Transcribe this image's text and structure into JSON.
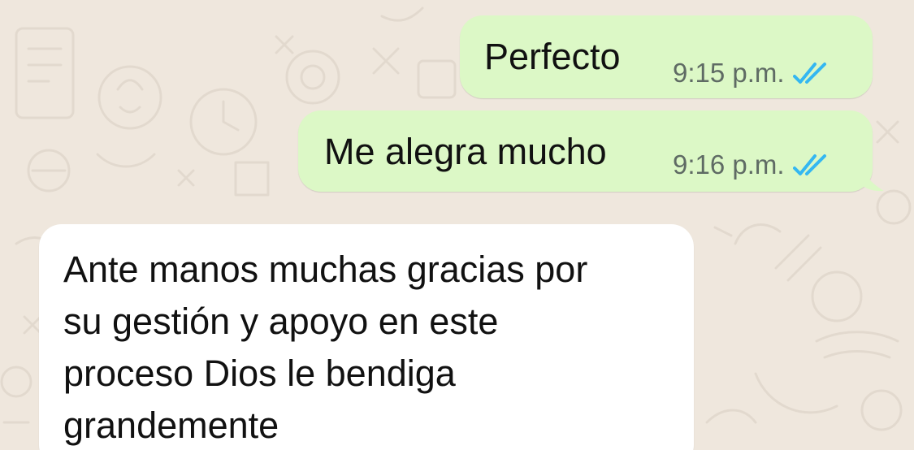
{
  "theme": {
    "wallpaper_color": "#efe7dd",
    "outgoing_bubble_color": "#dcf8c6",
    "incoming_bubble_color": "#ffffff",
    "read_tick_color": "#34b7f1"
  },
  "messages": [
    {
      "direction": "outgoing",
      "text": "Perfecto",
      "time": "9:15 p.m.",
      "status_icon": "double-check-read-icon"
    },
    {
      "direction": "outgoing",
      "text": "Me alegra mucho",
      "time": "9:16 p.m.",
      "status_icon": "double-check-read-icon"
    },
    {
      "direction": "incoming",
      "text": "Ante manos muchas gracias por\nsu gestión y apoyo en este\nproceso Dios le bendiga\ngrandemente"
    }
  ]
}
